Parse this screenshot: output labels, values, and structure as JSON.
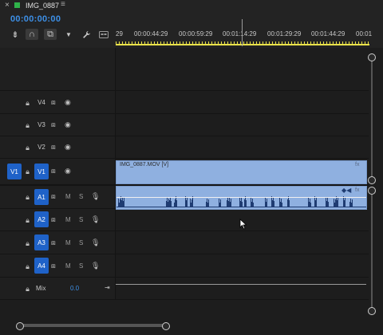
{
  "tab": {
    "close": "×",
    "title": "IMG_0887",
    "menu": "≡",
    "swatch_color": "#2fb24a"
  },
  "timecode": "00:00:00:00",
  "toolbar": [
    {
      "icon": "insert-overwrite-icon",
      "glyph": "⇟"
    },
    {
      "icon": "snap-icon",
      "glyph": "∩"
    },
    {
      "icon": "linked-selection-icon",
      "glyph": "⧉"
    },
    {
      "icon": "add-marker-icon",
      "glyph": "▼"
    },
    {
      "icon": "wrench-icon",
      "glyph": "🔧"
    },
    {
      "icon": "captions-icon",
      "glyph": "⊡"
    }
  ],
  "ruler": {
    "labels": [
      "29",
      "00:00:44:29",
      "00:00:59:29",
      "00:01:14:29",
      "00:01:29:29",
      "00:01:44:29",
      "00:01"
    ]
  },
  "video_tracks": [
    {
      "name": "V4",
      "source": ""
    },
    {
      "name": "V3",
      "source": ""
    },
    {
      "name": "V2",
      "source": ""
    },
    {
      "name": "V1",
      "source": "V1"
    }
  ],
  "audio_tracks": [
    {
      "name": "A1",
      "source": "A1",
      "m": "M",
      "s": "S"
    },
    {
      "name": "A2",
      "source": "",
      "m": "M",
      "s": "S"
    },
    {
      "name": "A3",
      "source": "",
      "m": "M",
      "s": "S"
    },
    {
      "name": "A4",
      "source": "",
      "m": "M",
      "s": "S"
    }
  ],
  "mix": {
    "label": "Mix",
    "value": "0.0"
  },
  "clips": {
    "video_label": "IMG_0887.MOV [V]",
    "fx": "fx",
    "clip_color": "#8fb0e0"
  },
  "accent": "#1f62c8"
}
